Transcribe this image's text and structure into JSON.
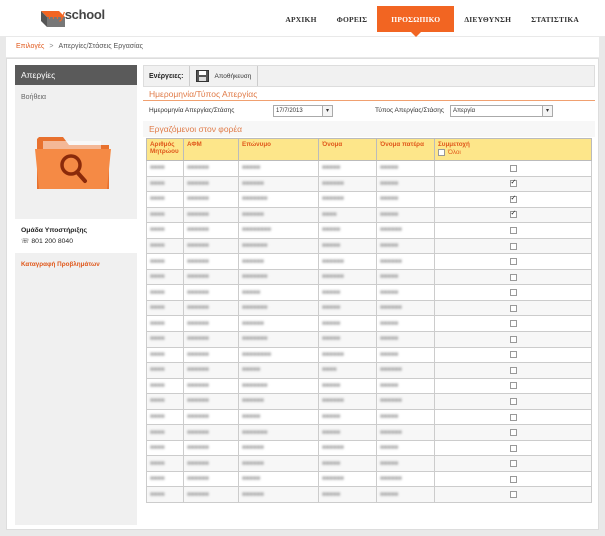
{
  "brand": {
    "prefix": "my",
    "name": "school"
  },
  "nav": [
    {
      "label": "ΑΡΧΙΚΗ",
      "active": false
    },
    {
      "label": "ΦΟΡΕΙΣ",
      "active": false
    },
    {
      "label": "ΠΡΟΣΩΠΙΚΟ",
      "active": true
    },
    {
      "label": "ΔΙΕΥΘΥΝΣΗ",
      "active": false
    },
    {
      "label": "ΣΤΑΤΙΣΤΙΚΑ",
      "active": false
    }
  ],
  "breadcrumb": {
    "root": "Επιλογές",
    "separator": ">",
    "current": "Απεργίες/Στάσεις Εργασίας"
  },
  "sidebar": {
    "title": "Απεργίες",
    "help": "Βοήθεια",
    "support_title": "Ομάδα Υποστήριξης",
    "support_phone": "801 200 8040",
    "report_link": "Καταγραφή Προβλημάτων"
  },
  "actions": {
    "label": "Ενέργειες:",
    "save": "Αποθήκευση"
  },
  "section1": {
    "title": "Ημερομηνία/Τύπος Απεργίας"
  },
  "filters": {
    "date_label": "Ημερομηνία Απεργίας/Στάσης",
    "date_value": "17/7/2013",
    "type_label": "Τύπος Απεργίας/Στάσης",
    "type_value": "Απεργία"
  },
  "section2": {
    "title": "Εργαζόμενοι στον φορέα"
  },
  "table": {
    "headers": [
      "Αριθμός Μητρώου",
      "ΑΦΜ",
      "Επώνυμο",
      "Όνομα",
      "Όνομα πατέρα",
      "Συμμετοχή"
    ],
    "check_all_label": "Όλοι",
    "rows": [
      {
        "c": [
          "■■■■",
          "■■■■■■",
          "■■■■■",
          "■■■■■",
          "■■■■■"
        ],
        "checked": false
      },
      {
        "c": [
          "■■■■",
          "■■■■■■",
          "■■■■■■",
          "■■■■■■",
          "■■■■■"
        ],
        "checked": true
      },
      {
        "c": [
          "■■■■",
          "■■■■■■",
          "■■■■■■■",
          "■■■■■■",
          "■■■■■"
        ],
        "checked": true
      },
      {
        "c": [
          "■■■■",
          "■■■■■■",
          "■■■■■■",
          "■■■■",
          "■■■■■"
        ],
        "checked": true
      },
      {
        "c": [
          "■■■■",
          "■■■■■■",
          "■■■■■■■■",
          "■■■■■",
          "■■■■■■"
        ],
        "checked": false
      },
      {
        "c": [
          "■■■■",
          "■■■■■■",
          "■■■■■■■",
          "■■■■■",
          "■■■■■"
        ],
        "checked": false
      },
      {
        "c": [
          "■■■■",
          "■■■■■■",
          "■■■■■■",
          "■■■■■■",
          "■■■■■■"
        ],
        "checked": false
      },
      {
        "c": [
          "■■■■",
          "■■■■■■",
          "■■■■■■■",
          "■■■■■■",
          "■■■■■"
        ],
        "checked": false
      },
      {
        "c": [
          "■■■■",
          "■■■■■■",
          "■■■■■",
          "■■■■■",
          "■■■■■"
        ],
        "checked": false
      },
      {
        "c": [
          "■■■■",
          "■■■■■■",
          "■■■■■■■",
          "■■■■■",
          "■■■■■■"
        ],
        "checked": false
      },
      {
        "c": [
          "■■■■",
          "■■■■■■",
          "■■■■■■",
          "■■■■■",
          "■■■■■"
        ],
        "checked": false
      },
      {
        "c": [
          "■■■■",
          "■■■■■■",
          "■■■■■■■",
          "■■■■■",
          "■■■■■"
        ],
        "checked": false
      },
      {
        "c": [
          "■■■■",
          "■■■■■■",
          "■■■■■■■■",
          "■■■■■■",
          "■■■■■"
        ],
        "checked": false
      },
      {
        "c": [
          "■■■■",
          "■■■■■■",
          "■■■■■",
          "■■■■",
          "■■■■■■"
        ],
        "checked": false
      },
      {
        "c": [
          "■■■■",
          "■■■■■■",
          "■■■■■■■",
          "■■■■■",
          "■■■■■"
        ],
        "checked": false
      },
      {
        "c": [
          "■■■■",
          "■■■■■■",
          "■■■■■■",
          "■■■■■■",
          "■■■■■■"
        ],
        "checked": false
      },
      {
        "c": [
          "■■■■",
          "■■■■■■",
          "■■■■■",
          "■■■■■",
          "■■■■■"
        ],
        "checked": false
      },
      {
        "c": [
          "■■■■",
          "■■■■■■",
          "■■■■■■■",
          "■■■■■",
          "■■■■■■"
        ],
        "checked": false
      },
      {
        "c": [
          "■■■■",
          "■■■■■■",
          "■■■■■■",
          "■■■■■■",
          "■■■■■"
        ],
        "checked": false
      },
      {
        "c": [
          "■■■■",
          "■■■■■■",
          "■■■■■■",
          "■■■■■",
          "■■■■■"
        ],
        "checked": false
      },
      {
        "c": [
          "■■■■",
          "■■■■■■",
          "■■■■■",
          "■■■■■■",
          "■■■■■■"
        ],
        "checked": false
      },
      {
        "c": [
          "■■■■",
          "■■■■■■",
          "■■■■■■",
          "■■■■■",
          "■■■■■"
        ],
        "checked": false
      }
    ]
  },
  "colors": {
    "accent": "#f26522",
    "header_bg": "#fde68a",
    "sidebar_head": "#5a5a5a"
  }
}
